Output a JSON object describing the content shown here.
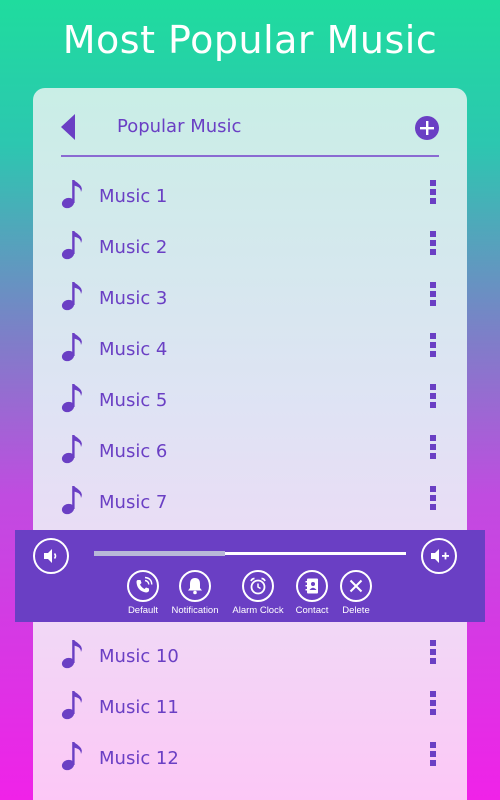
{
  "hero_title": "Most Popular Music",
  "header": {
    "title": "Popular Music",
    "back_icon": "back-arrow-icon",
    "add_icon": "plus-circle-icon"
  },
  "songs_top": [
    {
      "label": "Music 1"
    },
    {
      "label": "Music 2"
    },
    {
      "label": "Music 3"
    },
    {
      "label": "Music 4"
    },
    {
      "label": "Music 5"
    },
    {
      "label": "Music 6"
    },
    {
      "label": "Music 7"
    }
  ],
  "songs_bottom": [
    {
      "label": "Music 10"
    },
    {
      "label": "Music 11"
    },
    {
      "label": "Music 12"
    }
  ],
  "player": {
    "progress": 0.42,
    "volume_down_icon": "volume-down-icon",
    "volume_up_icon": "volume-up-icon",
    "actions": [
      {
        "label": "Default",
        "icon": "phone-ring-icon"
      },
      {
        "label": "Notification",
        "icon": "bell-icon"
      },
      {
        "label": "Alarm Clock",
        "icon": "alarm-clock-icon"
      },
      {
        "label": "Contact",
        "icon": "contact-book-icon"
      },
      {
        "label": "Delete",
        "icon": "close-icon"
      }
    ]
  },
  "colors": {
    "accent": "#6a3fc4",
    "player_bg": "#6a3fc4",
    "text_white": "#ffffff"
  }
}
